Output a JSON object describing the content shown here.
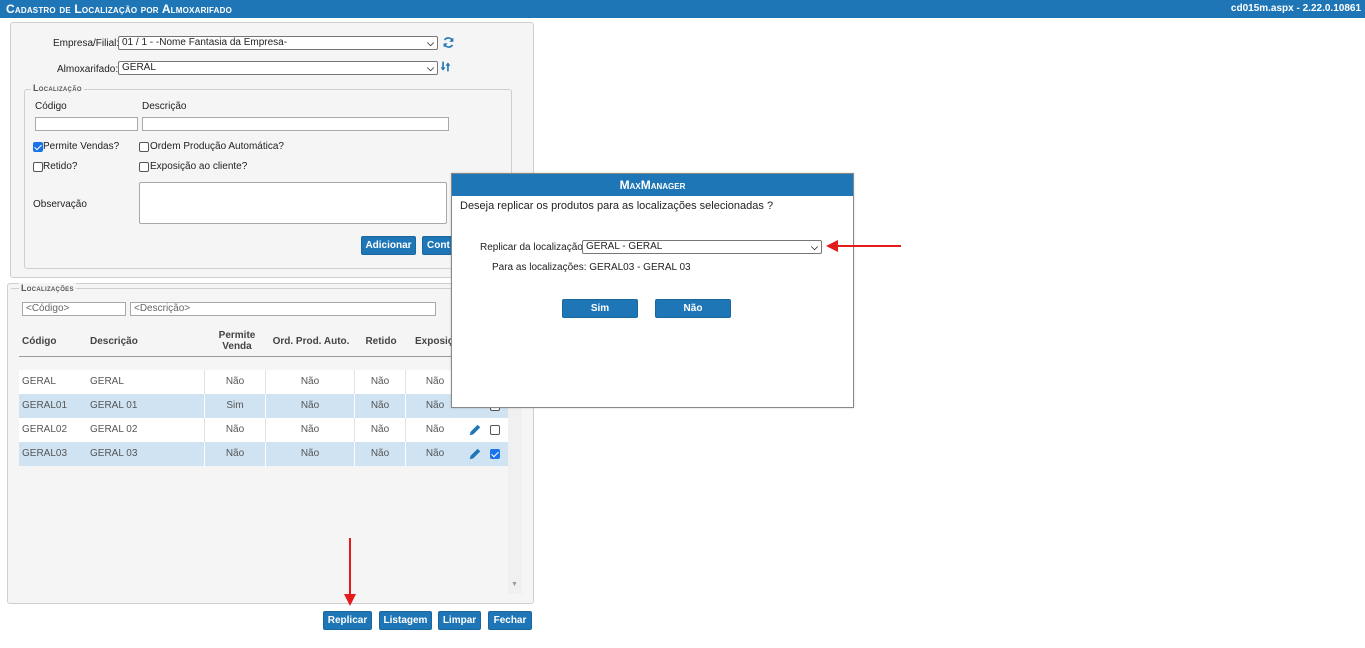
{
  "titlebar": {
    "title": "Cadastro de Localização por Almoxarifado",
    "version": "cd015m.aspx - 2.22.0.10861"
  },
  "form": {
    "empresa_label": "Empresa/Filial:",
    "empresa_value": "01 / 1 - -Nome Fantasia da Empresa-",
    "almox_label": "Almoxarifado:",
    "almox_value": "GERAL",
    "localizacao_legend": "Localização",
    "codigo_label": "Código",
    "descricao_label": "Descrição",
    "codigo_value": "",
    "descricao_value": "",
    "permite_vendas_label": "Permite Vendas?",
    "permite_vendas_checked": true,
    "ordem_producao_label": "Ordem Produção Automática?",
    "ordem_producao_checked": false,
    "retido_label": "Retido?",
    "retido_checked": false,
    "exposicao_label": "Exposição ao cliente?",
    "exposicao_checked": false,
    "observacao_label": "Observação",
    "observacao_value": "",
    "adicionar_label": "Adicionar",
    "cont_label": "Cont"
  },
  "localizacoes": {
    "legend": "Localizações",
    "filter_codigo_placeholder": "<Código>",
    "filter_descricao_placeholder": "<Descrição>",
    "headers": {
      "codigo": "Código",
      "descricao": "Descrição",
      "permite_venda": "Permite Venda",
      "ord_prod_auto": "Ord. Prod. Auto.",
      "retido": "Retido",
      "exposicao": "Exposiç"
    },
    "rows": [
      {
        "codigo": "GERAL",
        "descricao": "GERAL",
        "permite": "Não",
        "ordem": "Não",
        "retido": "Não",
        "exposicao": "Não",
        "checked": false
      },
      {
        "codigo": "GERAL01",
        "descricao": "GERAL 01",
        "permite": "Sim",
        "ordem": "Não",
        "retido": "Não",
        "exposicao": "Não",
        "checked": false
      },
      {
        "codigo": "GERAL02",
        "descricao": "GERAL 02",
        "permite": "Não",
        "ordem": "Não",
        "retido": "Não",
        "exposicao": "Não",
        "checked": false
      },
      {
        "codigo": "GERAL03",
        "descricao": "GERAL 03",
        "permite": "Não",
        "ordem": "Não",
        "retido": "Não",
        "exposicao": "Não",
        "checked": true
      }
    ]
  },
  "footer_buttons": {
    "replicar": "Replicar",
    "listagem": "Listagem",
    "limpar": "Limpar",
    "fechar": "Fechar"
  },
  "modal": {
    "title": "MaxManager",
    "question": "Deseja replicar os produtos para as localizações selecionadas ?",
    "replicar_label": "Replicar da localização:",
    "replicar_value": "GERAL - GERAL",
    "para_text": "Para as localizações: GERAL03 - GERAL 03",
    "sim_label": "Sim",
    "nao_label": "Não"
  },
  "colors": {
    "brand_blue": "#1f76b6",
    "row_highlight": "#cfe3f2",
    "annotation_red": "#e31b1b"
  }
}
